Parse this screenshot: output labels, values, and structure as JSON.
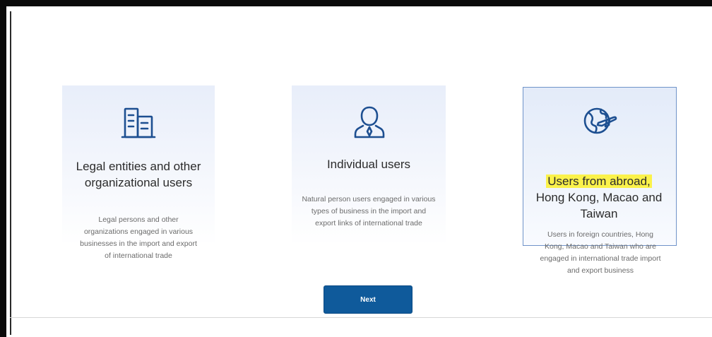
{
  "cards": [
    {
      "icon": "building-icon",
      "title": "Legal entities and other organizational users",
      "description": "Legal persons and other organizations engaged in various businesses in the import and export of international trade",
      "selected": false
    },
    {
      "icon": "user-icon",
      "title": "Individual users",
      "description": "Natural person users engaged in various types of business in the import and export links of international trade",
      "selected": false
    },
    {
      "icon": "globe-plane-icon",
      "title_highlight": "Users from abroad,",
      "title_rest": "Hong Kong, Macao and Taiwan",
      "description": "Users in foreign countries, Hong Kong, Macao and Taiwan who are engaged in international trade import and export business",
      "selected": true
    }
  ],
  "next_button": {
    "label": "Next"
  },
  "colors": {
    "accent": "#0f5a9b",
    "icon": "#1d4f91",
    "highlight": "#fbf24a",
    "selected_border": "#6f93c9"
  }
}
